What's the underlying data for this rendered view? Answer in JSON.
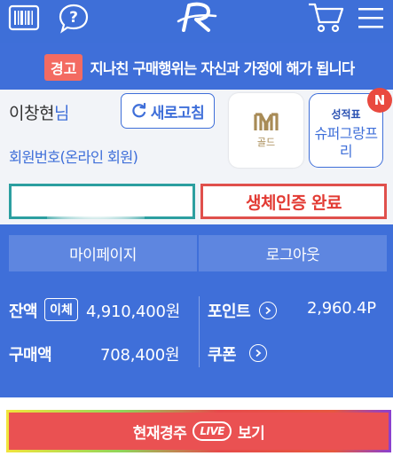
{
  "header": {
    "icons": [
      "barcode-icon",
      "help-icon",
      "logo",
      "cart-icon",
      "menu-icon"
    ]
  },
  "warning": {
    "badge": "경고",
    "text": "지나친 구매행위는 자신과 가정에 해가 됩니다"
  },
  "user": {
    "name": "이창현",
    "suffix": "님",
    "member_no": "회원번호(온라인 회원)",
    "refresh_label": "새로고침"
  },
  "grade": {
    "label": "골드"
  },
  "report": {
    "title": "성적표",
    "value": "슈퍼그랑프리",
    "badge": "N"
  },
  "auth": {
    "biometric": "생체인증 완료"
  },
  "nav": {
    "mypage": "마이페이지",
    "logout": "로그아웃"
  },
  "stats": {
    "balance_label": "잔액",
    "transfer_label": "이체",
    "balance_value": "4,910,400원",
    "point_label": "포인트",
    "point_value": "2,960.4P",
    "purchase_label": "구매액",
    "purchase_value": "708,400원",
    "coupon_label": "쿠폰"
  },
  "live": {
    "prefix": "현재경주",
    "pill": "LIVE",
    "suffix": "보기"
  },
  "colors": {
    "primary": "#3f6fd9",
    "danger": "#e23b34",
    "live": "#ea5152"
  }
}
